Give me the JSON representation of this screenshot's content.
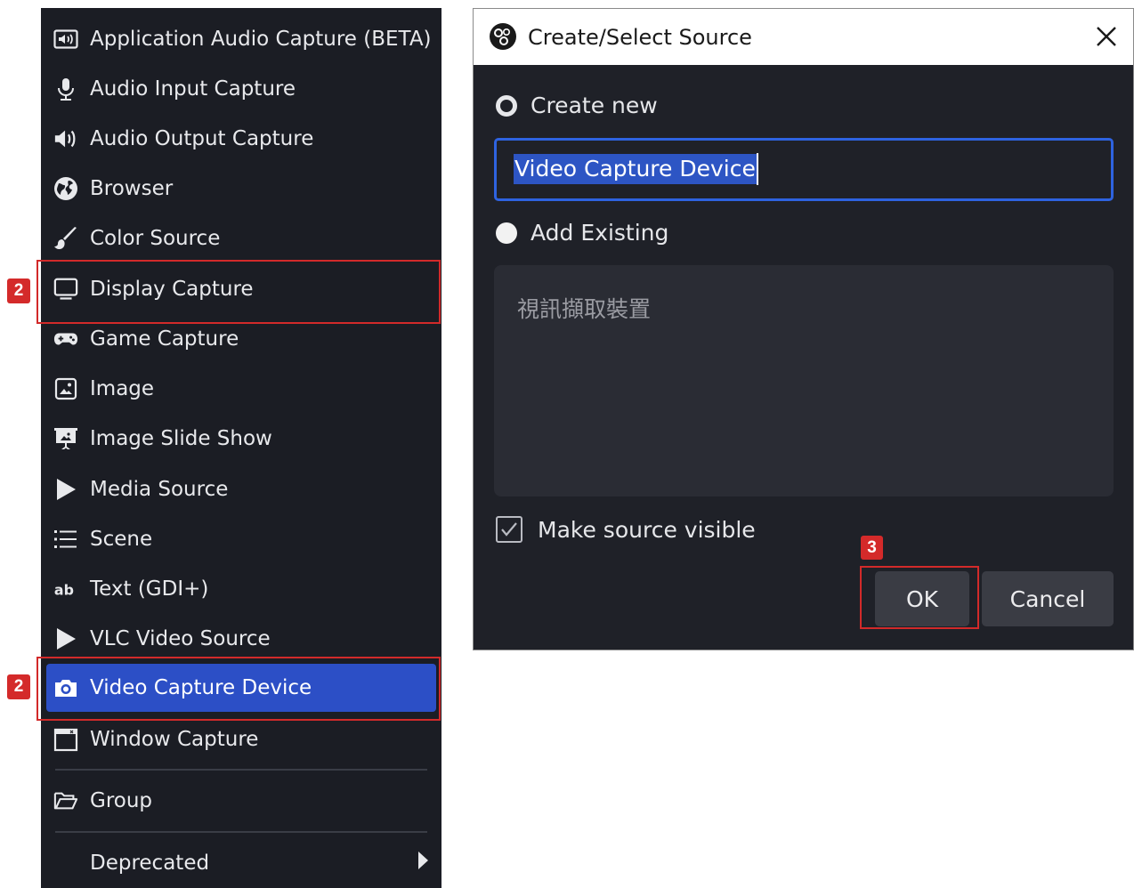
{
  "menu": {
    "items": [
      {
        "label": "Application Audio Capture (BETA)",
        "icon": "app-audio-capture-icon"
      },
      {
        "label": "Audio Input Capture",
        "icon": "microphone-icon"
      },
      {
        "label": "Audio Output Capture",
        "icon": "speaker-icon"
      },
      {
        "label": "Browser",
        "icon": "globe-icon"
      },
      {
        "label": "Color Source",
        "icon": "paintbrush-icon"
      },
      {
        "label": "Display Capture",
        "icon": "monitor-icon"
      },
      {
        "label": "Game Capture",
        "icon": "gamepad-icon"
      },
      {
        "label": "Image",
        "icon": "image-icon"
      },
      {
        "label": "Image Slide Show",
        "icon": "slideshow-icon"
      },
      {
        "label": "Media Source",
        "icon": "play-icon"
      },
      {
        "label": "Scene",
        "icon": "list-icon"
      },
      {
        "label": "Text (GDI+)",
        "icon": "text-icon"
      },
      {
        "label": "VLC Video Source",
        "icon": "play-icon"
      },
      {
        "label": "Video Capture Device",
        "icon": "camera-icon",
        "selected": true
      },
      {
        "label": "Window Capture",
        "icon": "window-icon"
      }
    ],
    "group_label": "Group",
    "deprecated_label": "Deprecated"
  },
  "annotations": {
    "display_capture_badge": "2",
    "video_capture_badge": "2",
    "ok_badge": "3"
  },
  "dialog": {
    "title": "Create/Select Source",
    "create_new_label": "Create new",
    "create_new_selected": true,
    "name_value": "Video Capture Device",
    "add_existing_label": "Add Existing",
    "existing_sources": [
      "視訊擷取裝置"
    ],
    "make_visible_label": "Make source visible",
    "make_visible_checked": true,
    "ok_label": "OK",
    "cancel_label": "Cancel"
  },
  "colors": {
    "menu_bg": "#1b1d24",
    "selected_bg": "#2c4fc6",
    "dialog_bg": "#1f2128",
    "input_focus": "#2e63e0",
    "annotation_red": "#d22a2a"
  }
}
